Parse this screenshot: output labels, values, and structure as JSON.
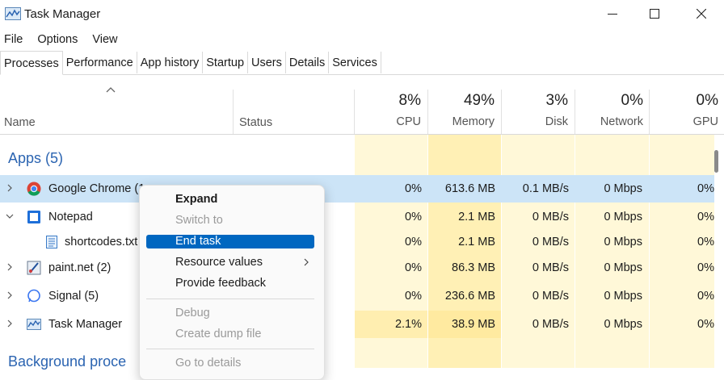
{
  "window": {
    "title": "Task Manager"
  },
  "menubar": [
    "File",
    "Options",
    "View"
  ],
  "tabs": [
    "Processes",
    "Performance",
    "App history",
    "Startup",
    "Users",
    "Details",
    "Services"
  ],
  "columns": {
    "name": "Name",
    "status": "Status",
    "cpu": {
      "pct": "8%",
      "label": "CPU"
    },
    "memory": {
      "pct": "49%",
      "label": "Memory"
    },
    "disk": {
      "pct": "3%",
      "label": "Disk"
    },
    "network": {
      "pct": "0%",
      "label": "Network"
    },
    "gpu": {
      "pct": "0%",
      "label": "GPU"
    }
  },
  "apps_group": "Apps (5)",
  "background_group": "Background proce",
  "rows": [
    {
      "name": "Google Chrome (1",
      "icon": "chrome-icon",
      "cpu": "0%",
      "memory": "613.6 MB",
      "disk": "0.1 MB/s",
      "network": "0 Mbps",
      "gpu": "0%"
    },
    {
      "name": "Notepad",
      "icon": "notepad-icon",
      "cpu": "0%",
      "memory": "2.1 MB",
      "disk": "0 MB/s",
      "network": "0 Mbps",
      "gpu": "0%"
    },
    {
      "name": "shortcodes.txt",
      "icon": "text-file-icon",
      "cpu": "0%",
      "memory": "2.1 MB",
      "disk": "0 MB/s",
      "network": "0 Mbps",
      "gpu": "0%"
    },
    {
      "name": "paint.net (2)",
      "icon": "paintnet-icon",
      "cpu": "0%",
      "memory": "86.3 MB",
      "disk": "0 MB/s",
      "network": "0 Mbps",
      "gpu": "0%"
    },
    {
      "name": "Signal (5)",
      "icon": "signal-icon",
      "cpu": "0%",
      "memory": "236.6 MB",
      "disk": "0 MB/s",
      "network": "0 Mbps",
      "gpu": "0%"
    },
    {
      "name": "Task Manager",
      "icon": "task-manager-icon",
      "cpu": "2.1%",
      "memory": "38.9 MB",
      "disk": "0 MB/s",
      "network": "0 Mbps",
      "gpu": "0%"
    }
  ],
  "context_menu": {
    "expand": "Expand",
    "switch_to": "Switch to",
    "end_task": "End task",
    "resource_values": "Resource values",
    "provide_feedback": "Provide feedback",
    "debug": "Debug",
    "create_dump": "Create dump file",
    "go_to_details": "Go to details"
  },
  "colors": {
    "accent": "#0067c0",
    "selection": "#cce4f7",
    "heat_light": "#fff8d8",
    "heat_medium": "#fff0b5",
    "group_title": "#2b64b1"
  }
}
